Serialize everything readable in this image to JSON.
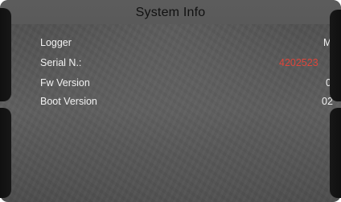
{
  "screen": {
    "title": "System Info"
  },
  "info_rows": [
    {
      "label": "Logger",
      "value": "M"
    },
    {
      "label": "Serial N.:",
      "value": "4202523"
    },
    {
      "label": "Fw Version",
      "value": "0"
    },
    {
      "label": "Boot Version",
      "value": "02"
    }
  ],
  "colors": {
    "screen_background": "#565656",
    "title_text": "#111111",
    "label_text": "#f2f2f2",
    "serial_value": "#e0453a",
    "bezel_buttons": "#111111"
  }
}
